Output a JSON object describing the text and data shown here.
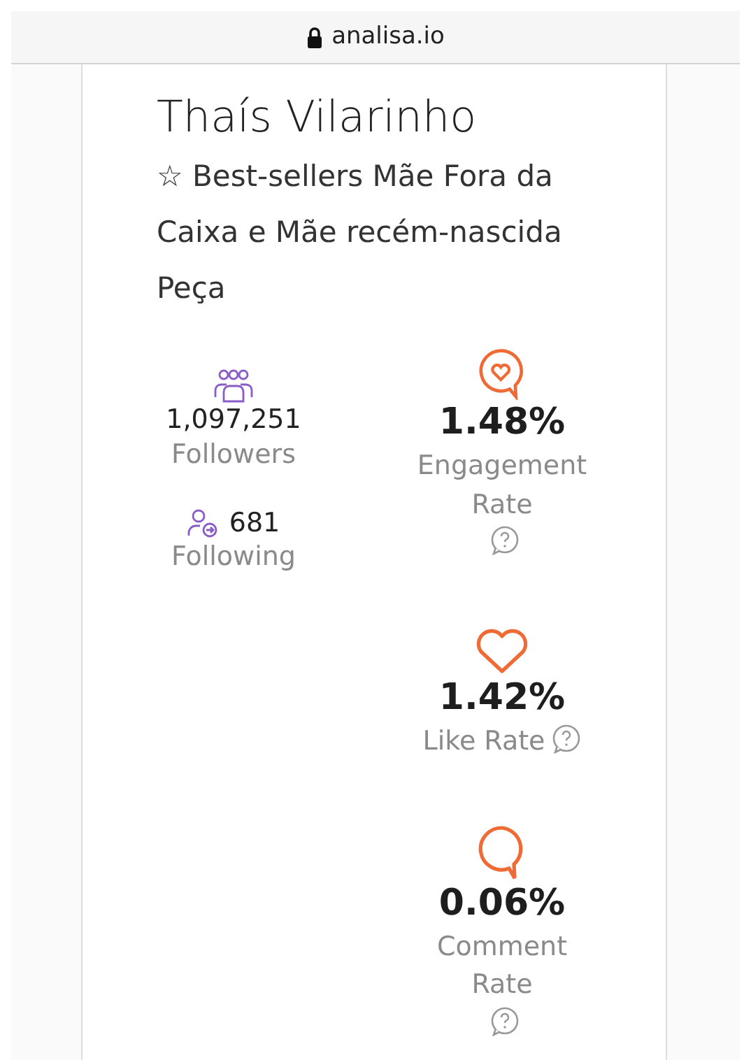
{
  "address_bar": {
    "url": "analisa.io",
    "secure": true
  },
  "profile": {
    "name": "Thaís Vilarinho",
    "bio": "☆ Best-sellers Mãe Fora da Caixa e Mãe recém-nascida Peça"
  },
  "audience": [
    {
      "kind": "followers",
      "count": "1,097,251",
      "label": "Followers"
    },
    {
      "kind": "following",
      "count": "681",
      "label": "Following"
    }
  ],
  "metrics": [
    {
      "kind": "engagement",
      "value": "1.48%",
      "label": "Engagement Rate"
    },
    {
      "kind": "like",
      "value": "1.42%",
      "label": "Like Rate"
    },
    {
      "kind": "comment",
      "value": "0.06%",
      "label": "Comment Rate"
    }
  ]
}
